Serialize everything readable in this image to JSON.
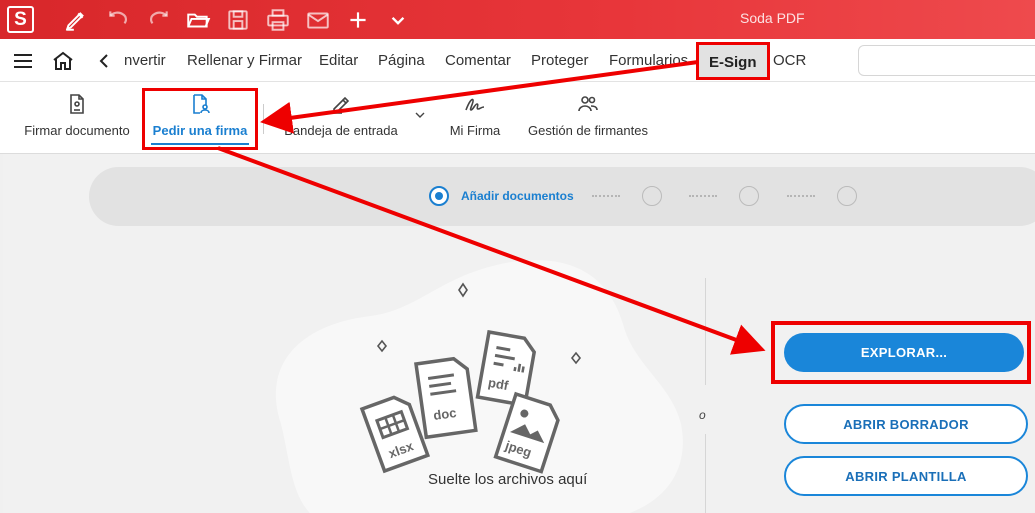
{
  "app": {
    "logo_letter": "S",
    "title": "Soda PDF",
    "brand_color": "#e3312f",
    "accent_color": "#1a86d9"
  },
  "toolbar_icons": [
    "pen-icon",
    "undo-icon",
    "redo-icon",
    "open-folder-icon",
    "save-icon",
    "print-icon",
    "email-icon",
    "add-icon",
    "chevron-down-icon"
  ],
  "menu": {
    "items": [
      {
        "label": "nvertir"
      },
      {
        "label": "Rellenar y Firmar"
      },
      {
        "label": "Editar"
      },
      {
        "label": "Página"
      },
      {
        "label": "Comentar"
      },
      {
        "label": "Proteger"
      },
      {
        "label": "Formularios"
      },
      {
        "label": "E-Sign",
        "active": true
      },
      {
        "label": "OCR"
      }
    ],
    "search_placeholder": ""
  },
  "ribbon": {
    "items": [
      {
        "label": "Firmar documento",
        "icon": "sign-document-icon"
      },
      {
        "label": "Pedir una firma",
        "icon": "request-signature-icon",
        "selected": true
      },
      {
        "label": "Bandeja de entrada",
        "icon": "inbox-pen-icon"
      },
      {
        "label": "Mi Firma",
        "icon": "signature-icon"
      },
      {
        "label": "Gestión de firmantes",
        "icon": "signers-icon"
      }
    ]
  },
  "stepper": {
    "active_label": "Añadir documentos",
    "total_steps": 4,
    "current_step": 1
  },
  "dropzone": {
    "text": "Suelte los archivos aquí",
    "file_types": [
      "doc",
      "pdf",
      "xlsx",
      "jpeg"
    ]
  },
  "separator_text": "o",
  "actions": {
    "explore": "EXPLORAR...",
    "open_draft": "ABRIR BORRADOR",
    "open_template": "ABRIR PLANTILLA"
  }
}
